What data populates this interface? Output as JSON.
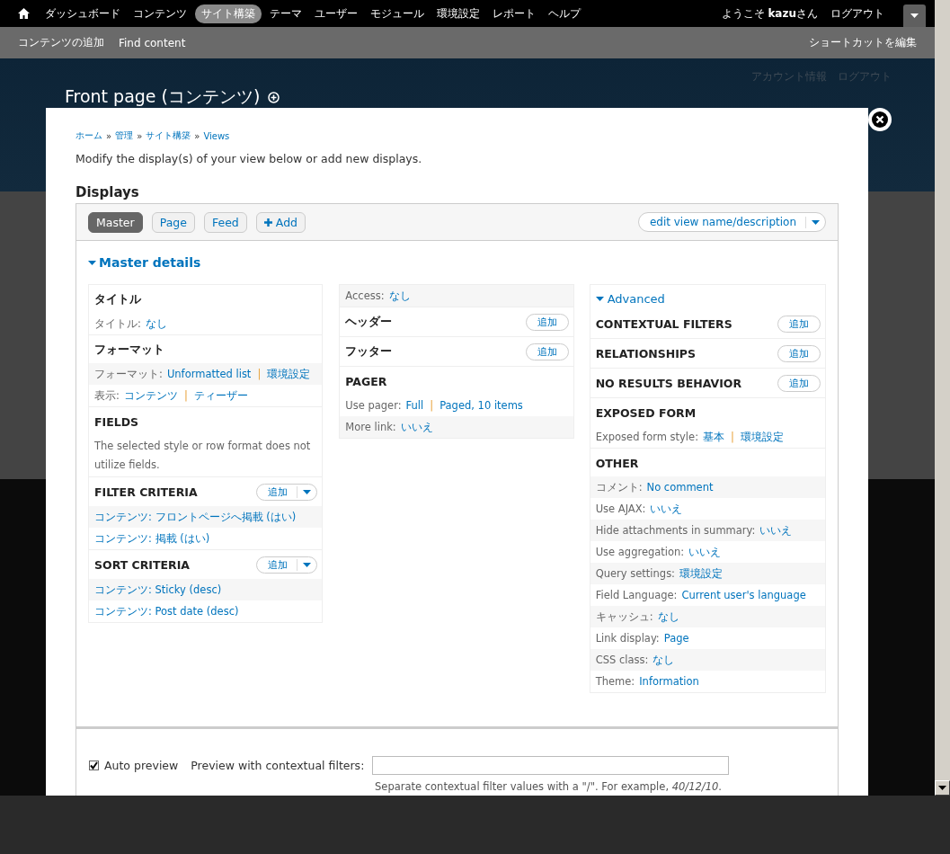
{
  "toolbar": {
    "items": [
      {
        "label": "ダッシュボード",
        "selected": false
      },
      {
        "label": "コンテンツ",
        "selected": false
      },
      {
        "label": "サイト構築",
        "selected": true
      },
      {
        "label": "テーマ",
        "selected": false
      },
      {
        "label": "ユーザー",
        "selected": false
      },
      {
        "label": "モジュール",
        "selected": false
      },
      {
        "label": "環境設定",
        "selected": false
      },
      {
        "label": "レポート",
        "selected": false
      },
      {
        "label": "ヘルプ",
        "selected": false
      }
    ],
    "welcome": "ようこそ **kazu**さん",
    "logout": "ログアウト"
  },
  "shortcuts": {
    "items": [
      "コンテンツの追加",
      "Find content"
    ],
    "edit": "ショートカットを編集"
  },
  "page": {
    "title": "Front page (コンテンツ)",
    "user_links": [
      "アカウント情報",
      "ログアウト"
    ]
  },
  "modal": {
    "breadcrumb": {
      "links": [
        "ホーム",
        "管理",
        "サイト構築",
        "Views"
      ],
      "separator": "»"
    },
    "description": "Modify the display(s) of your view below or add new displays.",
    "displays_heading": "Displays",
    "tabs": [
      {
        "label": "Master",
        "selected": true,
        "kind": "display"
      },
      {
        "label": "Page",
        "selected": false,
        "kind": "display"
      },
      {
        "label": "Feed",
        "selected": false,
        "kind": "display"
      },
      {
        "label": "Add",
        "selected": false,
        "kind": "add"
      }
    ],
    "edit_button": "edit view name/description",
    "details": {
      "title": "Master details",
      "expanded": true
    },
    "columns": [
      {
        "sections": [
          {
            "title": "タイトル",
            "rows": [
              {
                "kind": "setting",
                "label": "タイトル:",
                "links": [
                  "なし"
                ],
                "shaded": false
              }
            ]
          },
          {
            "title": "フォーマット",
            "rows": [
              {
                "kind": "setting",
                "label": "フォーマット:",
                "links": [
                  "Unformatted list",
                  "環境設定"
                ],
                "separator": "|",
                "shaded": true
              },
              {
                "kind": "setting",
                "label": "表示:",
                "links": [
                  "コンテンツ",
                  "ティーザー"
                ],
                "separator": "|",
                "shaded": false
              }
            ]
          },
          {
            "title": "FIELDS",
            "rows": [
              {
                "kind": "note",
                "text": "The selected style or row format does not utilize fields.",
                "shaded": false
              }
            ]
          },
          {
            "title": "FILTER CRITERIA",
            "add": {
              "label": "追加",
              "dropdown": true
            },
            "rows": [
              {
                "kind": "setting",
                "links": [
                  "コンテンツ: フロントページへ掲載 (はい)"
                ],
                "shaded": true
              },
              {
                "kind": "setting",
                "links": [
                  "コンテンツ: 掲載 (はい)"
                ],
                "shaded": false
              }
            ]
          },
          {
            "title": "SORT CRITERIA",
            "add": {
              "label": "追加",
              "dropdown": true
            },
            "rows": [
              {
                "kind": "setting",
                "links": [
                  "コンテンツ: Sticky (desc)"
                ],
                "shaded": true
              },
              {
                "kind": "setting",
                "links": [
                  "コンテンツ: Post date (desc)"
                ],
                "shaded": false
              }
            ]
          }
        ]
      },
      {
        "sections": [
          {
            "rows": [
              {
                "kind": "setting",
                "label": "Access:",
                "links": [
                  "なし"
                ],
                "shaded": true
              }
            ]
          },
          {
            "title": "ヘッダー",
            "add": {
              "label": "追加",
              "dropdown": false
            }
          },
          {
            "title": "フッター",
            "add": {
              "label": "追加",
              "dropdown": false
            }
          },
          {
            "title": "PAGER",
            "rows": [
              {
                "kind": "setting",
                "label": "Use pager:",
                "links": [
                  "Full",
                  "Paged, 10 items"
                ],
                "separator": "|",
                "shaded": false
              },
              {
                "kind": "setting",
                "label": "More link:",
                "links": [
                  "いいえ"
                ],
                "shaded": true
              }
            ]
          }
        ]
      },
      {
        "toggle": {
          "label": "Advanced",
          "expanded": true
        },
        "sections": [
          {
            "title": "CONTEXTUAL FILTERS",
            "add": {
              "label": "追加",
              "dropdown": false
            }
          },
          {
            "title": "RELATIONSHIPS",
            "add": {
              "label": "追加",
              "dropdown": false
            }
          },
          {
            "title": "NO RESULTS BEHAVIOR",
            "add": {
              "label": "追加",
              "dropdown": false
            }
          },
          {
            "title": "EXPOSED FORM",
            "rows": [
              {
                "kind": "setting",
                "label": "Exposed form style:",
                "links": [
                  "基本",
                  "環境設定"
                ],
                "separator": "|",
                "shaded": false
              }
            ]
          },
          {
            "title": "OTHER",
            "rows": [
              {
                "kind": "setting",
                "label": "コメント:",
                "links": [
                  "No comment"
                ],
                "shaded": true
              },
              {
                "kind": "setting",
                "label": "Use AJAX:",
                "links": [
                  "いいえ"
                ],
                "shaded": false
              },
              {
                "kind": "setting",
                "label": "Hide attachments in summary:",
                "links": [
                  "いいえ"
                ],
                "shaded": true
              },
              {
                "kind": "setting",
                "label": "Use aggregation:",
                "links": [
                  "いいえ"
                ],
                "shaded": false
              },
              {
                "kind": "setting",
                "label": "Query settings:",
                "links": [
                  "環境設定"
                ],
                "shaded": true
              },
              {
                "kind": "setting",
                "label": "Field Language:",
                "links": [
                  "Current user's language"
                ],
                "shaded": false
              },
              {
                "kind": "setting",
                "label": "キャッシュ:",
                "links": [
                  "なし"
                ],
                "shaded": true
              },
              {
                "kind": "setting",
                "label": "Link display:",
                "links": [
                  "Page"
                ],
                "shaded": false
              },
              {
                "kind": "setting",
                "label": "CSS class:",
                "links": [
                  "なし"
                ],
                "shaded": true
              },
              {
                "kind": "setting",
                "label": "Theme:",
                "links": [
                  "Information"
                ],
                "shaded": false
              }
            ]
          }
        ]
      }
    ],
    "preview": {
      "auto_preview": {
        "label": "Auto preview",
        "checked": true
      },
      "filters_label": "Preview with contextual filters:",
      "hint": "Separate contextual filter values with a \"/\". For example, *40/12/10*."
    }
  }
}
